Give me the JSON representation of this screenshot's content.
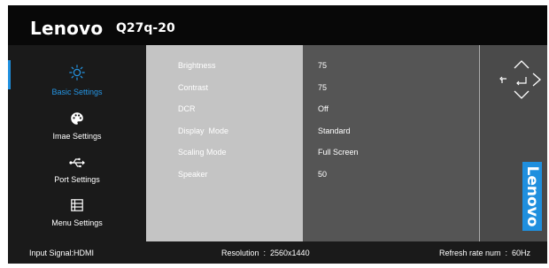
{
  "header": {
    "brand": "Lenovo",
    "model": "Q27q-20"
  },
  "sidebar": {
    "items": [
      {
        "label": "Basic Settings",
        "icon": "brightness-icon",
        "active": true
      },
      {
        "label": "Imae Settings",
        "icon": "palette-icon",
        "active": false
      },
      {
        "label": "Port Settings",
        "icon": "usb-icon",
        "active": false
      },
      {
        "label": "Menu Settings",
        "icon": "menu-list-icon",
        "active": false
      }
    ]
  },
  "settings": {
    "rows": [
      {
        "label": "Brightness",
        "value": "75"
      },
      {
        "label": "Contrast",
        "value": "75"
      },
      {
        "label": "DCR",
        "value": "Off"
      },
      {
        "label": "Display  Mode",
        "value": "Standard"
      },
      {
        "label": "Scaling Mode",
        "value": "Full Screen"
      },
      {
        "label": "Speaker",
        "value": "50"
      }
    ]
  },
  "navigation_hint": {
    "icons": [
      "up-arrow-icon",
      "back-icon",
      "enter-icon",
      "right-arrow-icon",
      "down-arrow-icon"
    ]
  },
  "side_logo": {
    "text": "Lenovo"
  },
  "footer": {
    "input_signal": "Input Signal:HDMI",
    "resolution": "Resolution  :  2560x1440",
    "refresh_rate": "Refresh rate num  :  60Hz"
  },
  "colors": {
    "accent": "#1f8fde",
    "header_bg": "#080808",
    "sidebar_bg": "#1a1a1a",
    "content_bg": "#c4c4c4",
    "values_bg": "#555555"
  }
}
